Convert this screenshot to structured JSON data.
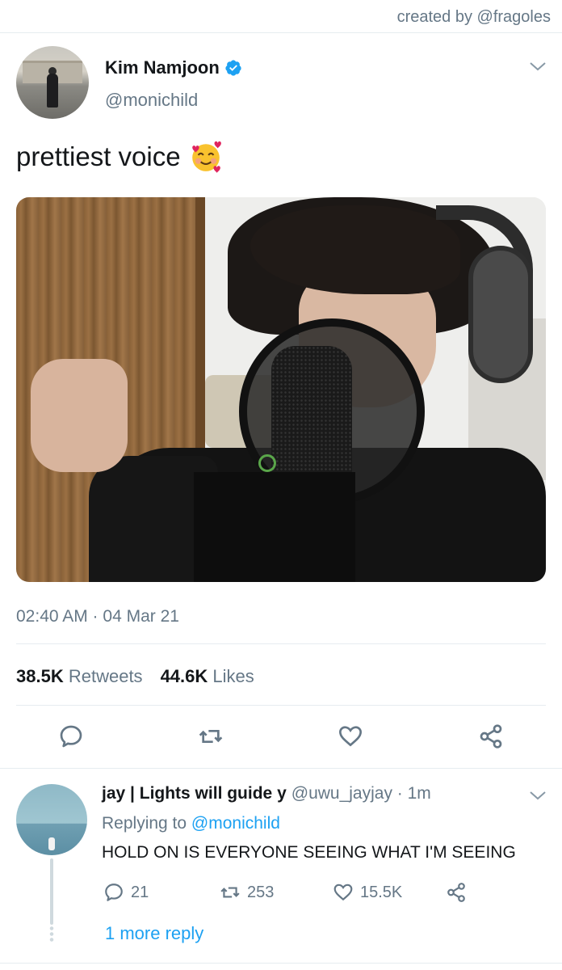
{
  "credit": "created by @fragoles",
  "tweet": {
    "author_name": "Kim Namjoon",
    "author_handle": "@monichild",
    "text": "prettiest voice",
    "emoji": "smiling-face-with-hearts",
    "timestamp": "02:40 AM · 04 Mar 21",
    "retweets_count": "38.5K",
    "retweets_label": "Retweets",
    "likes_count": "44.6K",
    "likes_label": "Likes"
  },
  "reply": {
    "author_name": "jay | Lights will guide y",
    "author_handle": "@uwu_jayjay · 1m",
    "replying_prefix": "Replying to",
    "replying_to": "@monichild",
    "text": "HOLD ON IS EVERYONE SEEING WHAT I'M SEEING",
    "reply_count": "21",
    "retweet_count": "253",
    "like_count": "15.5K",
    "more_replies": "1 more reply"
  },
  "colors": {
    "link": "#1da1f2",
    "muted": "#657786",
    "text": "#14171a",
    "verified": "#1da1f2"
  }
}
